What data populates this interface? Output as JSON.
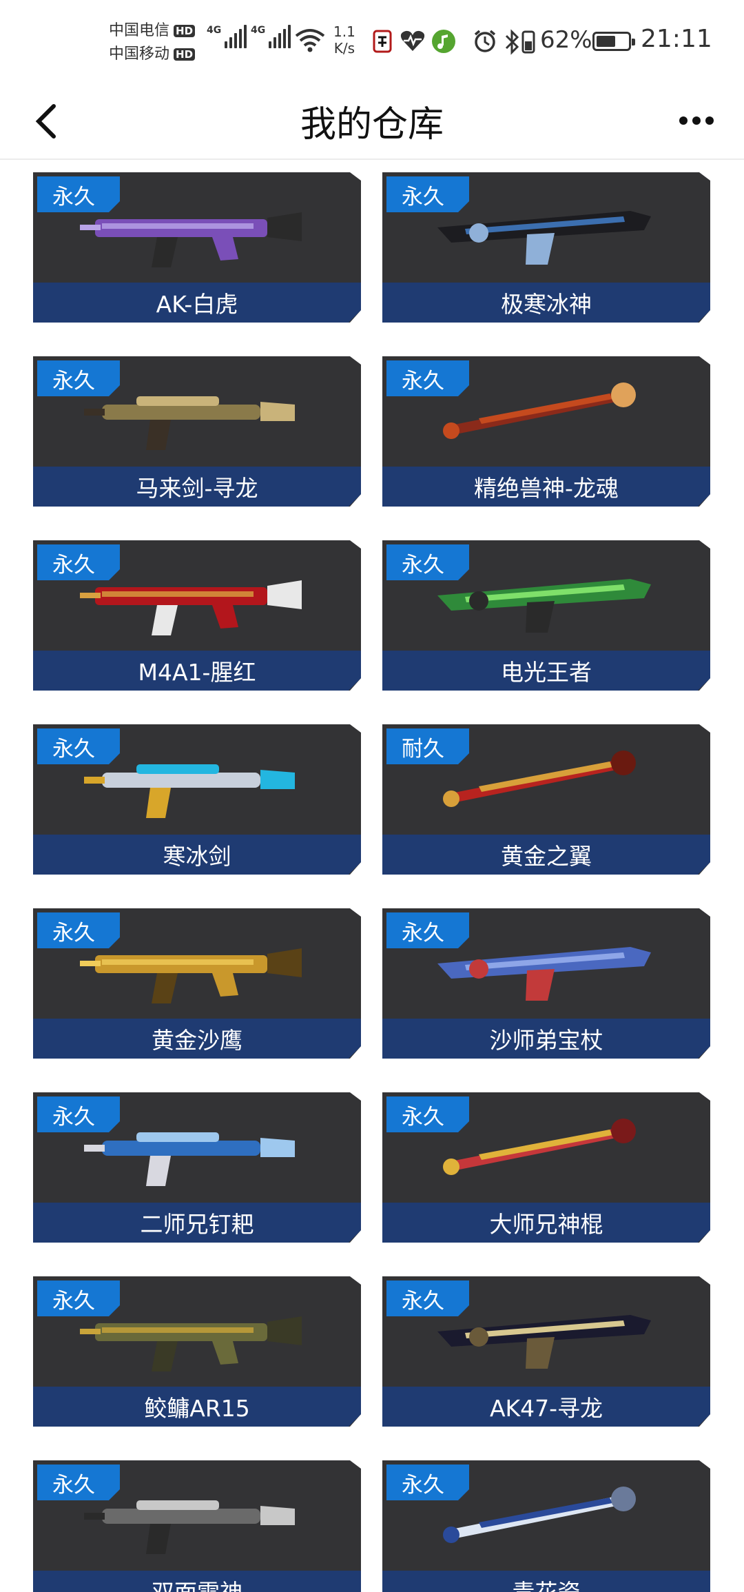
{
  "status_bar": {
    "carrier_1": "中国电信",
    "carrier_2": "中国移动",
    "hd_badge": "HD",
    "network_1": "4G",
    "network_2": "4G",
    "speed_value": "1.1",
    "speed_unit": "K/s",
    "battery_percent": "62%",
    "battery_level": 0.62,
    "time": "21:11"
  },
  "nav": {
    "title": "我的仓库"
  },
  "items": [
    {
      "name": "AK-白虎",
      "tag": "永久",
      "colors": [
        "#7a4fb8",
        "#b9a4e8",
        "#2a2a2a"
      ]
    },
    {
      "name": "极寒冰神",
      "tag": "永久",
      "colors": [
        "#1c1c20",
        "#3c6fb0",
        "#8fb0d8"
      ]
    },
    {
      "name": "马来剑-寻龙",
      "tag": "永久",
      "colors": [
        "#8a7a4a",
        "#c9b37a",
        "#3a3026"
      ]
    },
    {
      "name": "精绝兽神-龙魂",
      "tag": "永久",
      "colors": [
        "#8b2a1a",
        "#c54a1e",
        "#e0a25a"
      ]
    },
    {
      "name": "M4A1-腥红",
      "tag": "永久",
      "colors": [
        "#b3161c",
        "#d8a040",
        "#e8e8e8"
      ]
    },
    {
      "name": "电光王者",
      "tag": "永久",
      "colors": [
        "#2f8a3a",
        "#7fe06a",
        "#2a2a2a"
      ]
    },
    {
      "name": "寒冰剑",
      "tag": "永久",
      "colors": [
        "#c8d0dc",
        "#23b6e0",
        "#d8a62a"
      ]
    },
    {
      "name": "黄金之翼",
      "tag": "耐久",
      "colors": [
        "#b8231f",
        "#d8a03a",
        "#6a1a10"
      ]
    },
    {
      "name": "黄金沙鹰",
      "tag": "永久",
      "colors": [
        "#c9982c",
        "#f0cc5a",
        "#5a4216"
      ]
    },
    {
      "name": "沙师弟宝杖",
      "tag": "永久",
      "colors": [
        "#4a68c0",
        "#8ea6e8",
        "#c23a3a"
      ]
    },
    {
      "name": "二师兄钉耙",
      "tag": "永久",
      "colors": [
        "#2f6fc0",
        "#9ec8ee",
        "#d8d8e0"
      ]
    },
    {
      "name": "大师兄神棍",
      "tag": "永久",
      "colors": [
        "#c5373a",
        "#e0b23a",
        "#7a1a1a"
      ]
    },
    {
      "name": "鲛鳙AR15",
      "tag": "永久",
      "colors": [
        "#6a6a3a",
        "#c9a43a",
        "#3a3a26"
      ]
    },
    {
      "name": "AK47-寻龙",
      "tag": "永久",
      "colors": [
        "#1a1a2e",
        "#d8c890",
        "#6a5a3a"
      ]
    },
    {
      "name": "双面雷神",
      "tag": "永久",
      "colors": [
        "#6a6a6a",
        "#c8c8c8",
        "#2a2a2a"
      ]
    },
    {
      "name": "青花瓷",
      "tag": "永久",
      "colors": [
        "#dde6f3",
        "#2a4a9a",
        "#6a7a9a"
      ]
    }
  ]
}
